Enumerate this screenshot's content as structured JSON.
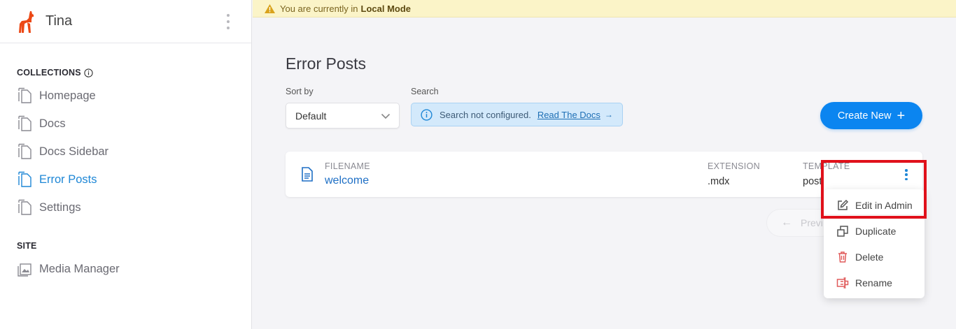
{
  "app": {
    "title": "Tina"
  },
  "banner": {
    "prefix": "You are currently in",
    "mode": "Local Mode"
  },
  "sidebar": {
    "collections_title": "COLLECTIONS",
    "items": [
      {
        "label": "Homepage",
        "icon": "document-icon",
        "active": false
      },
      {
        "label": "Docs",
        "icon": "document-icon",
        "active": false
      },
      {
        "label": "Docs Sidebar",
        "icon": "document-icon",
        "active": false
      },
      {
        "label": "Error Posts",
        "icon": "document-icon",
        "active": true
      },
      {
        "label": "Settings",
        "icon": "document-icon",
        "active": false
      }
    ],
    "site_title": "SITE",
    "media_label": "Media Manager"
  },
  "main": {
    "title": "Error Posts",
    "sort_label": "Sort by",
    "sort_value": "Default",
    "search_label": "Search",
    "search_note": "Search not configured.",
    "search_link": "Read The Docs",
    "create_label": "Create New",
    "columns": {
      "filename": "FILENAME",
      "extension": "EXTENSION",
      "template": "TEMPLATE"
    },
    "row": {
      "filename": "welcome",
      "extension": ".mdx",
      "template": "post"
    },
    "prev_label": "Previ"
  },
  "menu": {
    "edit": "Edit in Admin",
    "duplicate": "Duplicate",
    "delete": "Delete",
    "rename": "Rename"
  },
  "colors": {
    "accent": "#0b85f0",
    "active_link": "#1e87d6",
    "brand": "#ec4815",
    "danger": "#e05b5b",
    "highlight": "#e0111b"
  }
}
